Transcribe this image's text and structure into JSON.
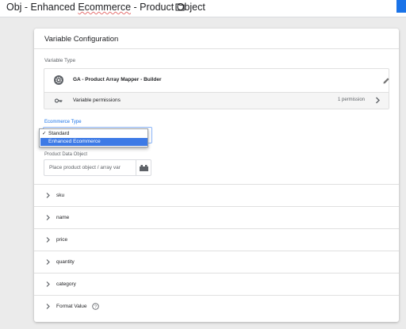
{
  "header": {
    "title_prefix": "Obj - Enhanced ",
    "title_marked": "Ecommerce",
    "title_suffix": " - Product Object",
    "folder_icon": "folder-icon",
    "accent_color": "#1a73e8"
  },
  "card": {
    "title": "Variable Configuration",
    "variable_type": {
      "label": "Variable Type",
      "name": "GA - Product Array Mapper - Builder",
      "icon": "gear-icon",
      "edit_icon": "pencil-icon",
      "permissions_label": "Variable permissions",
      "permissions_count": "1 permission"
    },
    "ecommerce_type": {
      "label": "Ecommerce Type",
      "options": [
        {
          "label": "Standard",
          "checked": true
        },
        {
          "label": "Enhanced Ecommerce",
          "highlighted": true
        }
      ]
    },
    "product_data": {
      "label": "Product Data Object",
      "placeholder": "Place product object / array var"
    },
    "fields": [
      {
        "label": "sku"
      },
      {
        "label": "name"
      },
      {
        "label": "price"
      },
      {
        "label": "quantity"
      },
      {
        "label": "category"
      },
      {
        "label": "Format Value",
        "help_icon": "help-circle-icon"
      }
    ]
  }
}
